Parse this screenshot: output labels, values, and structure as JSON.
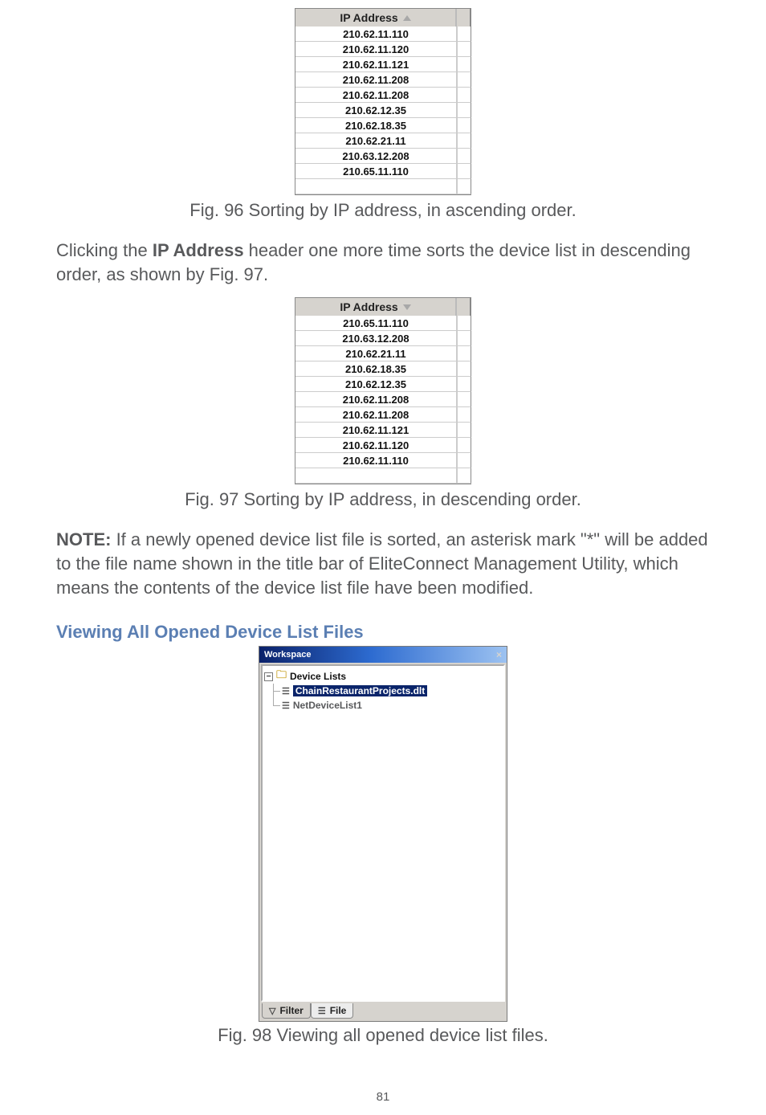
{
  "fig96": {
    "header": "IP Address",
    "sort": "asc",
    "rows": [
      "210.62.11.110",
      "210.62.11.120",
      "210.62.11.121",
      "210.62.11.208",
      "210.62.11.208",
      "210.62.12.35",
      "210.62.18.35",
      "210.62.21.11",
      "210.63.12.208",
      "210.65.11.110"
    ],
    "caption": "Fig. 96 Sorting by IP address, in ascending order."
  },
  "para1": {
    "pre": "Clicking the ",
    "bold": "IP Address",
    "post": " header one more time sorts the device list in descending order, as shown by Fig. 97."
  },
  "fig97": {
    "header": "IP Address",
    "sort": "desc",
    "rows": [
      "210.65.11.110",
      "210.63.12.208",
      "210.62.21.11",
      "210.62.18.35",
      "210.62.12.35",
      "210.62.11.208",
      "210.62.11.208",
      "210.62.11.121",
      "210.62.11.120",
      "210.62.11.110"
    ],
    "caption": "Fig. 97 Sorting by IP address, in descending order."
  },
  "note": {
    "label": "NOTE:",
    "text": " If a newly opened device list file is sorted, an asterisk mark \"*\" will be added to the file name shown in the title bar of EliteConnect Management Utility, which means the contents of the device list file have been modified."
  },
  "section_heading": "Viewing All Opened Device List Files",
  "workspace": {
    "title": "Workspace",
    "close": "×",
    "toggle": "−",
    "root": "Device Lists",
    "items": [
      {
        "label": "ChainRestaurantProjects.dlt",
        "selected": true
      },
      {
        "label": "NetDeviceList1",
        "selected": false
      }
    ],
    "tabs": {
      "filter_icon": "▽",
      "filter": "Filter",
      "file_icon": "☰",
      "file": "File"
    }
  },
  "fig98_caption": "Fig. 98 Viewing all opened device list files.",
  "page_number": "81"
}
